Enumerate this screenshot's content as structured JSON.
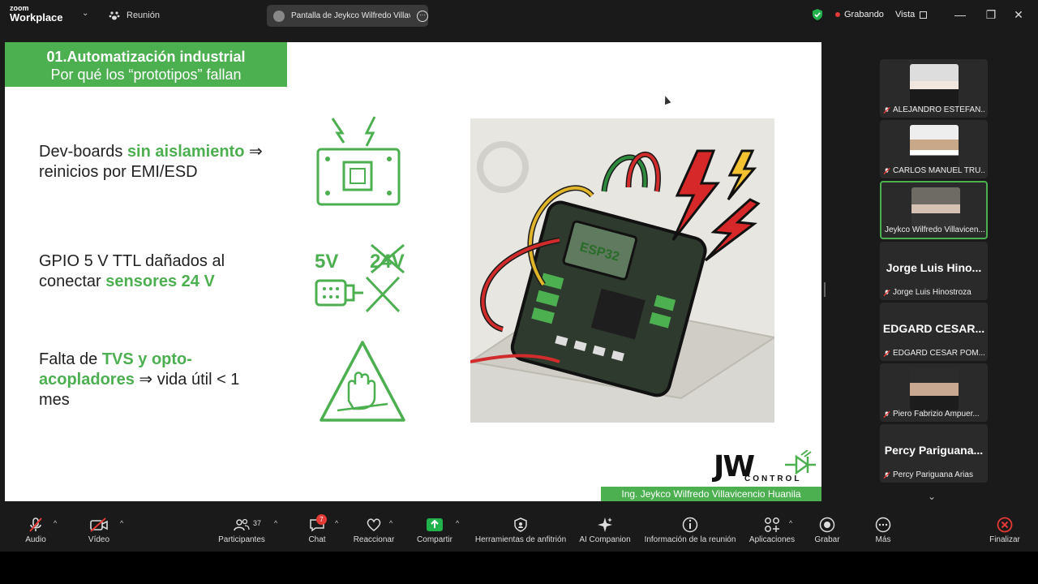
{
  "app": {
    "logo_top": "zoom",
    "logo_bottom": "Workplace",
    "meeting_label": "Reunión",
    "share_tab": "Pantalla de Jeykco Wilfredo Villav",
    "recording": "Grabando",
    "view": "Vista"
  },
  "slide": {
    "header_line1": "01.Automatización industrial",
    "header_line2": "Por qué los “prototipos” fallan",
    "b1_pre": "Dev-boards ",
    "b1_green": "sin aislamiento",
    "b1_post": " ⇒",
    "b1_line2": "reinicios por EMI/ESD",
    "b2_line1": "GPIO 5 V TTL dañados al",
    "b2_pre": "conectar ",
    "b2_green": "sensores 24 V",
    "b3_pre": "Falta de ",
    "b3_green1": "TVS y opto-",
    "b3_green2": "acopladores",
    "b3_post": " ⇒ vida útil < 1",
    "b3_line3": "mes",
    "icon_5v": "5V",
    "icon_24v": "24V",
    "chip_label": "ESP32",
    "brand_main": "JW",
    "brand_sub": "CONTROL",
    "author": "Ing. Jeykco Wilfredo Villavicencio Huanila"
  },
  "participants": [
    {
      "name": "ALEJANDRO ESTEFAN..."
    },
    {
      "name": "CARLOS MANUEL TRU..."
    },
    {
      "name": "Jeykco Wilfredo Villavicen..."
    },
    {
      "big": "Jorge Luis Hino...",
      "name": "Jorge Luis Hinostroza"
    },
    {
      "big": "EDGARD CESAR...",
      "name": "EDGARD CESAR POM..."
    },
    {
      "name": "Piero Fabrizio Ampuer..."
    },
    {
      "big": "Percy Pariguana...",
      "name": "Percy Pariguana Arias"
    }
  ],
  "toolbar": {
    "audio": "Audio",
    "video": "Vídeo",
    "participants": "Participantes",
    "participants_count": "37",
    "chat": "Chat",
    "chat_badge": "7",
    "react": "Reaccionar",
    "share": "Compartir",
    "host_tools": "Herramientas de anfitrión",
    "ai": "AI Companion",
    "info": "Información de la reunión",
    "apps": "Aplicaciones",
    "record": "Grabar",
    "more": "Más",
    "end": "Finalizar"
  },
  "colors": {
    "accent_green": "#4caf50",
    "recording_red": "#e53935"
  }
}
